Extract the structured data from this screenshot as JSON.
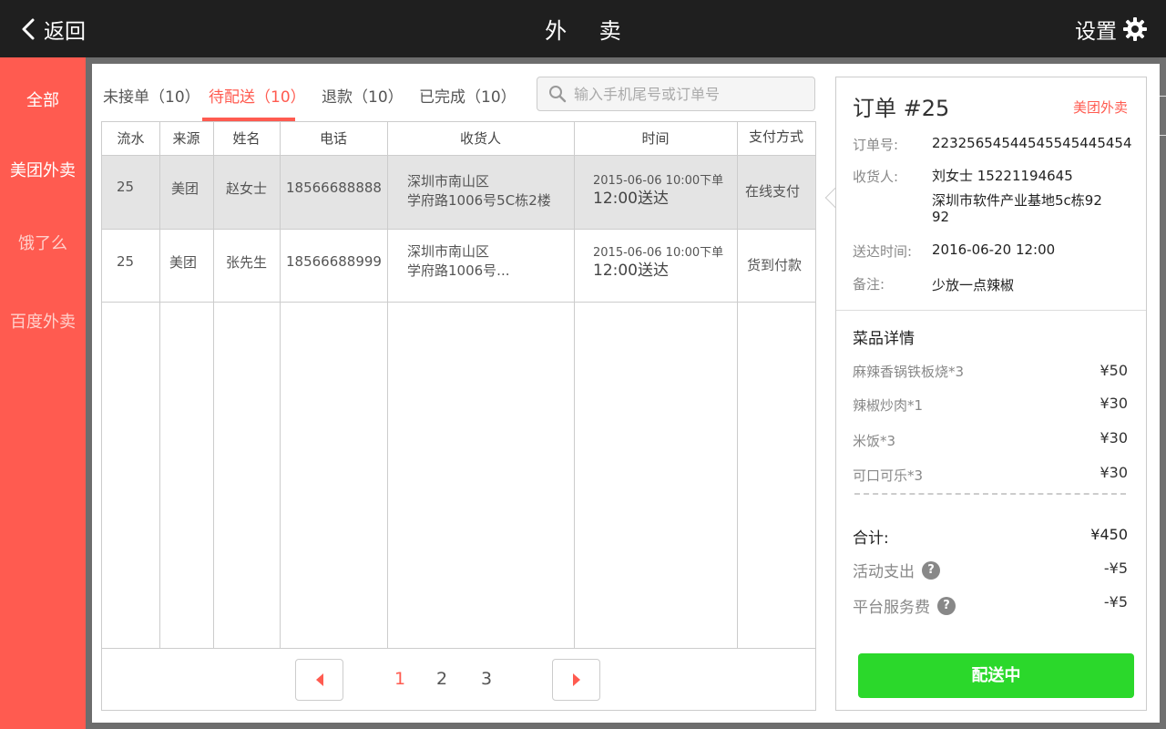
{
  "header": {
    "back_label": "返回",
    "title": "外 卖",
    "settings_label": "设置",
    "back_icon": "chevron-left-icon",
    "settings_icon": "gear-icon"
  },
  "sidebar": {
    "items": [
      {
        "label": "全部"
      },
      {
        "label": "美团外卖"
      },
      {
        "label": "饿了么"
      },
      {
        "label": "百度外卖"
      }
    ]
  },
  "tabs": [
    {
      "label": "未接单（10）"
    },
    {
      "label": "待配送（10）",
      "active": true
    },
    {
      "label": "退款（10）"
    },
    {
      "label": "已完成（10）"
    }
  ],
  "search": {
    "placeholder": "输入手机尾号或订单号",
    "value": "",
    "icon": "search-icon"
  },
  "table": {
    "headers": [
      "流水",
      "来源",
      "姓名",
      "电话",
      "收货人",
      "时间",
      "支付方式"
    ],
    "rows": [
      {
        "serial": "25",
        "source": "美团",
        "name": "赵女士",
        "phone": "18566688888",
        "addr1": "深圳市南山区",
        "addr2": "学府路1006号5C栋2楼",
        "order_time": "2015-06-06 10:00下单",
        "deliver_time": "12:00送达",
        "payment": "在线支付",
        "selected": true
      },
      {
        "serial": "25",
        "source": "美团",
        "name": "张先生",
        "phone": "18566688999",
        "addr1": "深圳市南山区",
        "addr2": "学府路1006号...",
        "order_time": "2015-06-06 10:00下单",
        "deliver_time": "12:00送达",
        "payment": "货到付款",
        "selected": false
      }
    ]
  },
  "pagination": {
    "pages": [
      "1",
      "2",
      "3"
    ],
    "current": "1"
  },
  "order": {
    "title": "订单 #25",
    "source": "美团外卖",
    "number_label": "订单号:",
    "number": "22325654544545545445454",
    "receiver_label": "收货人:",
    "receiver": "刘女士    15221194645",
    "address_line1": "深圳市软件产业基地5c栋92",
    "address_line2": "92",
    "delivery_label": "送达时间:",
    "delivery_time": "2016-06-20  12:00",
    "note_label": "备注:",
    "note": "少放一点辣椒",
    "dishes_title": "菜品详情",
    "dishes": [
      {
        "name": "麻辣香锅铁板烧*3",
        "price": "¥50"
      },
      {
        "name": "辣椒炒肉*1",
        "price": "¥30"
      },
      {
        "name": "米饭*3",
        "price": "¥30"
      },
      {
        "name": "可口可乐*3",
        "price": "¥30"
      }
    ],
    "total_label": "合计:",
    "total": "¥450",
    "activity_label": "活动支出",
    "activity": "-¥5",
    "service_label": "平台服务费",
    "service": "-¥5",
    "help_glyph": "?",
    "action_label": "配送中"
  },
  "colors": {
    "accent": "#ff5b50",
    "topbar": "#1f1f1f",
    "success": "#2bd82b"
  }
}
